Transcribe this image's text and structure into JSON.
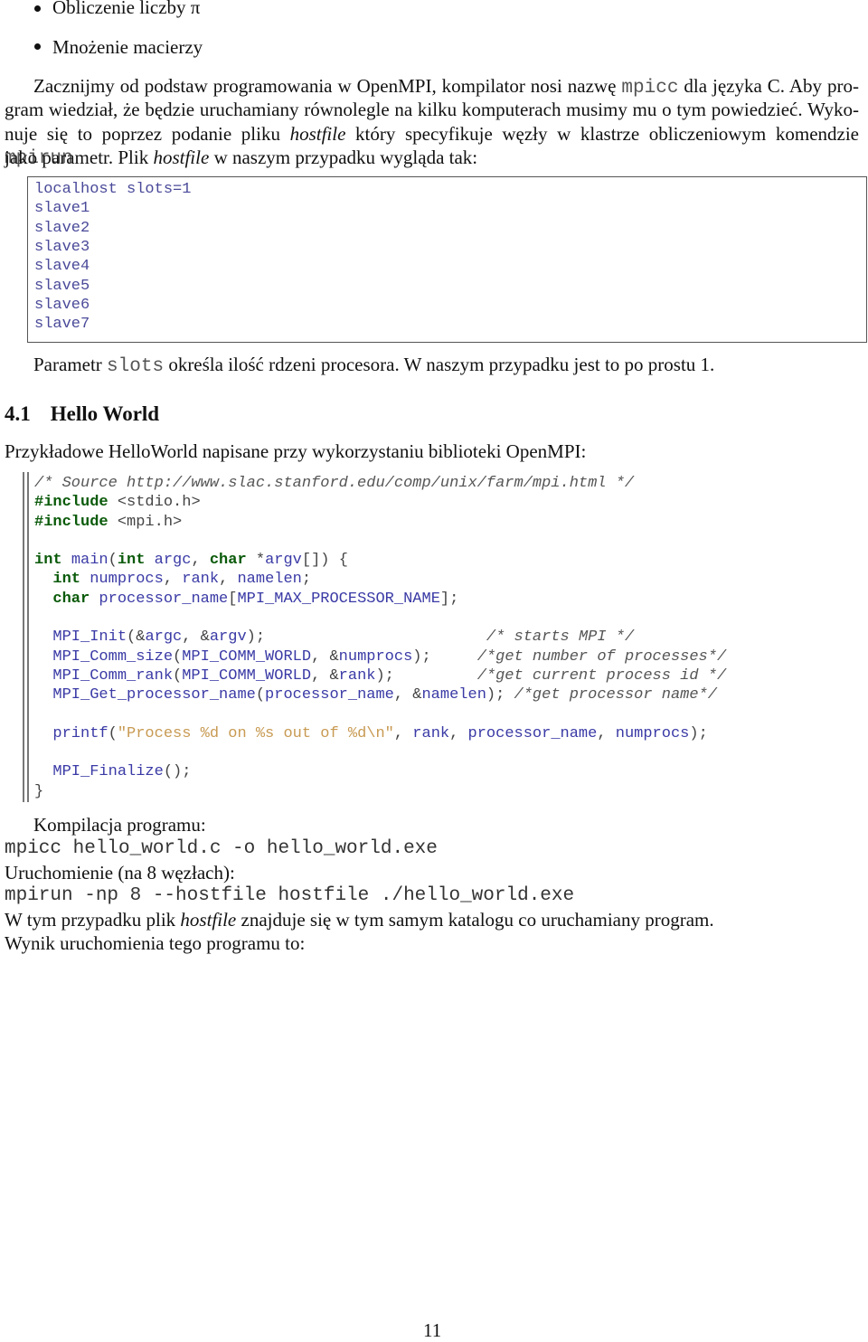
{
  "bullets": [
    "Obliczenie liczby π",
    "Mnożenie macierzy"
  ],
  "intro_lines": [
    [
      {
        "t": "Zacznijmy od podstaw programowania w OpenMPI, kompilator nosi nazwę "
      },
      {
        "m": "mpicc"
      },
      {
        "t": " dla języka C. Aby pro-"
      }
    ],
    [
      {
        "t": "gram wiedział, że będzie uruchamiany równolegle na kilku komputerach musimy mu o tym powiedzieć. Wyko-"
      }
    ],
    [
      {
        "t": "nuje się to poprzez podanie pliku "
      },
      {
        "i": "hostfile"
      },
      {
        "t": " który specyfikuje węzły w klastrze obliczeniowym komendzie "
      },
      {
        "m": "mpirun"
      }
    ],
    [
      {
        "t": "jako parametr. Plik "
      },
      {
        "i": "hostfile"
      },
      {
        "t": " w naszym przypadku wygląda tak:"
      }
    ]
  ],
  "hostfile": [
    "localhost slots=1",
    "slave1",
    "slave2",
    "slave3",
    "slave4",
    "slave5",
    "slave6",
    "slave7"
  ],
  "slots_note": [
    {
      "t": "Parametr "
    },
    {
      "m": "slots"
    },
    {
      "t": " określa ilość rdzeni procesora. W naszym przypadku jest to po prostu 1."
    }
  ],
  "section": {
    "number": "4.1",
    "title": "Hello World"
  },
  "section_intro": "Przykładowe HelloWorld napisane przy wykorzystaniu biblioteki OpenMPI:",
  "code": [
    [
      [
        "c",
        "/* Source http://www.slac.stanford.edu/comp/unix/farm/mpi.html */"
      ]
    ],
    [
      [
        "k",
        "#include"
      ],
      [
        "p",
        " <stdio.h>"
      ]
    ],
    [
      [
        "k",
        "#include"
      ],
      [
        "p",
        " <mpi.h>"
      ]
    ],
    [],
    [
      [
        "k",
        "int"
      ],
      [
        "p",
        " "
      ],
      [
        "i",
        "main"
      ],
      [
        "p",
        "("
      ],
      [
        "k",
        "int"
      ],
      [
        "p",
        " "
      ],
      [
        "i",
        "argc"
      ],
      [
        "p",
        ", "
      ],
      [
        "k",
        "char"
      ],
      [
        "p",
        " *"
      ],
      [
        "i",
        "argv"
      ],
      [
        "p",
        "[]) {"
      ]
    ],
    [
      [
        "p",
        "  "
      ],
      [
        "k",
        "int"
      ],
      [
        "p",
        " "
      ],
      [
        "i",
        "numprocs"
      ],
      [
        "p",
        ", "
      ],
      [
        "i",
        "rank"
      ],
      [
        "p",
        ", "
      ],
      [
        "i",
        "namelen"
      ],
      [
        "p",
        ";"
      ]
    ],
    [
      [
        "p",
        "  "
      ],
      [
        "k",
        "char"
      ],
      [
        "p",
        " "
      ],
      [
        "i",
        "processor_name"
      ],
      [
        "p",
        "["
      ],
      [
        "i",
        "MPI_MAX_PROCESSOR_NAME"
      ],
      [
        "p",
        "];"
      ]
    ],
    [],
    [
      [
        "p",
        "  "
      ],
      [
        "i",
        "MPI_Init"
      ],
      [
        "p",
        "(&"
      ],
      [
        "i",
        "argc"
      ],
      [
        "p",
        ", &"
      ],
      [
        "i",
        "argv"
      ],
      [
        "p",
        ");                        "
      ],
      [
        "c",
        "/* starts MPI */"
      ]
    ],
    [
      [
        "p",
        "  "
      ],
      [
        "i",
        "MPI_Comm_size"
      ],
      [
        "p",
        "("
      ],
      [
        "i",
        "MPI_COMM_WORLD"
      ],
      [
        "p",
        ", &"
      ],
      [
        "i",
        "numprocs"
      ],
      [
        "p",
        ");     "
      ],
      [
        "c",
        "/*get number of processes*/"
      ]
    ],
    [
      [
        "p",
        "  "
      ],
      [
        "i",
        "MPI_Comm_rank"
      ],
      [
        "p",
        "("
      ],
      [
        "i",
        "MPI_COMM_WORLD"
      ],
      [
        "p",
        ", &"
      ],
      [
        "i",
        "rank"
      ],
      [
        "p",
        ");         "
      ],
      [
        "c",
        "/*get current process id */"
      ]
    ],
    [
      [
        "p",
        "  "
      ],
      [
        "i",
        "MPI_Get_processor_name"
      ],
      [
        "p",
        "("
      ],
      [
        "i",
        "processor_name"
      ],
      [
        "p",
        ", &"
      ],
      [
        "i",
        "namelen"
      ],
      [
        "p",
        "); "
      ],
      [
        "c",
        "/*get processor name*/"
      ]
    ],
    [],
    [
      [
        "p",
        "  "
      ],
      [
        "i",
        "printf"
      ],
      [
        "p",
        "("
      ],
      [
        "s",
        "\"Process %d on %s out of %d\\n\""
      ],
      [
        "p",
        ", "
      ],
      [
        "i",
        "rank"
      ],
      [
        "p",
        ", "
      ],
      [
        "i",
        "processor_name"
      ],
      [
        "p",
        ", "
      ],
      [
        "i",
        "numprocs"
      ],
      [
        "p",
        ");"
      ]
    ],
    [],
    [
      [
        "p",
        "  "
      ],
      [
        "i",
        "MPI_Finalize"
      ],
      [
        "p",
        "();"
      ]
    ],
    [
      [
        "p",
        "}"
      ]
    ]
  ],
  "compile_label": "Kompilacja programu:",
  "compile_cmd": "mpicc hello_world.c -o hello_world.exe",
  "run_label": "Uruchomienie (na 8 węzłach):",
  "run_cmd": "mpirun -np 8 --hostfile hostfile ./hello_world.exe",
  "hostfile_note": [
    {
      "t": "W tym przypadku plik "
    },
    {
      "i": "hostfile"
    },
    {
      "t": " znajduje się w tym samym katalogu co uruchamiany program."
    }
  ],
  "result_label": "Wynik uruchomienia tego programu to:",
  "page_number": "11"
}
